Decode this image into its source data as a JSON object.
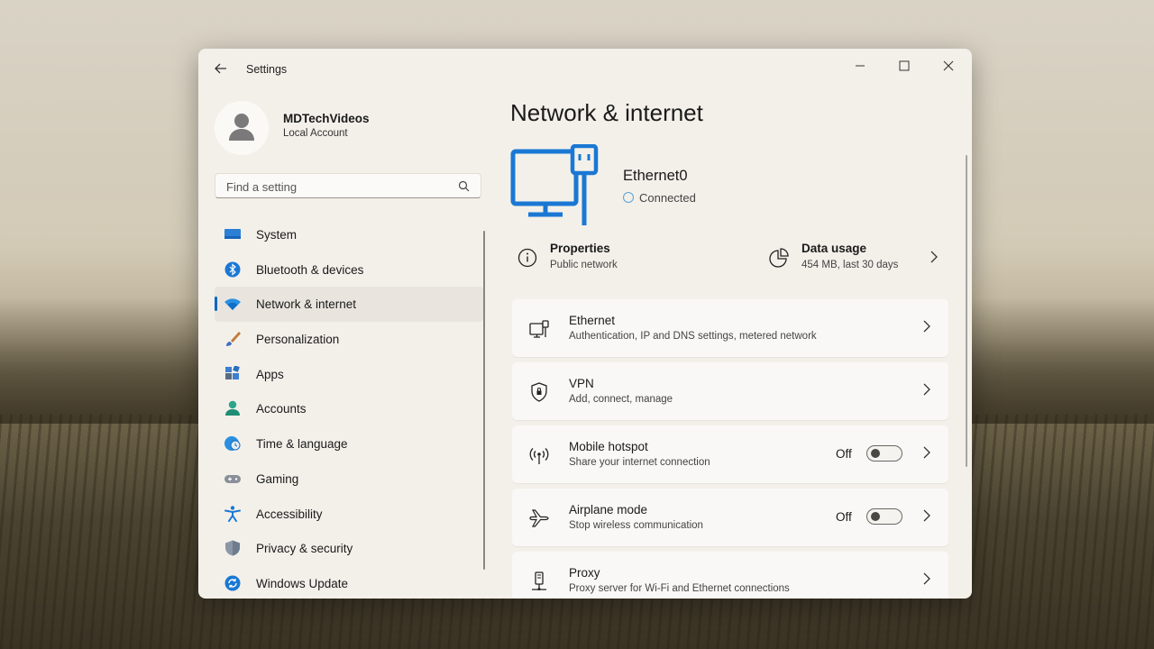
{
  "window": {
    "title": "Settings"
  },
  "profile": {
    "name": "MDTechVideos",
    "account_type": "Local Account"
  },
  "search": {
    "placeholder": "Find a setting"
  },
  "sidebar": {
    "items": [
      {
        "label": "System",
        "icon": "system-icon"
      },
      {
        "label": "Bluetooth & devices",
        "icon": "bluetooth-icon"
      },
      {
        "label": "Network & internet",
        "icon": "wifi-icon",
        "active": true
      },
      {
        "label": "Personalization",
        "icon": "brush-icon"
      },
      {
        "label": "Apps",
        "icon": "apps-icon"
      },
      {
        "label": "Accounts",
        "icon": "person-icon"
      },
      {
        "label": "Time & language",
        "icon": "clock-globe-icon"
      },
      {
        "label": "Gaming",
        "icon": "gamepad-icon"
      },
      {
        "label": "Accessibility",
        "icon": "accessibility-icon"
      },
      {
        "label": "Privacy & security",
        "icon": "shield-icon"
      },
      {
        "label": "Windows Update",
        "icon": "update-icon"
      }
    ]
  },
  "main": {
    "title": "Network & internet",
    "adapter": {
      "name": "Ethernet0",
      "status": "Connected"
    },
    "properties": {
      "title": "Properties",
      "subtitle": "Public network"
    },
    "data_usage": {
      "title": "Data usage",
      "subtitle": "454 MB, last 30 days"
    },
    "cards": [
      {
        "title": "Ethernet",
        "subtitle": "Authentication, IP and DNS settings, metered network",
        "icon": "ethernet-icon"
      },
      {
        "title": "VPN",
        "subtitle": "Add, connect, manage",
        "icon": "vpn-shield-icon"
      },
      {
        "title": "Mobile hotspot",
        "subtitle": "Share your internet connection",
        "icon": "hotspot-icon",
        "toggle": "Off"
      },
      {
        "title": "Airplane mode",
        "subtitle": "Stop wireless communication",
        "icon": "airplane-icon",
        "toggle": "Off"
      },
      {
        "title": "Proxy",
        "subtitle": "Proxy server for Wi-Fi and Ethernet connections",
        "icon": "proxy-icon"
      }
    ]
  },
  "colors": {
    "accent": "#0067c0",
    "window_bg": "#f3f0ea",
    "card_bg": "#f9f8f6"
  }
}
